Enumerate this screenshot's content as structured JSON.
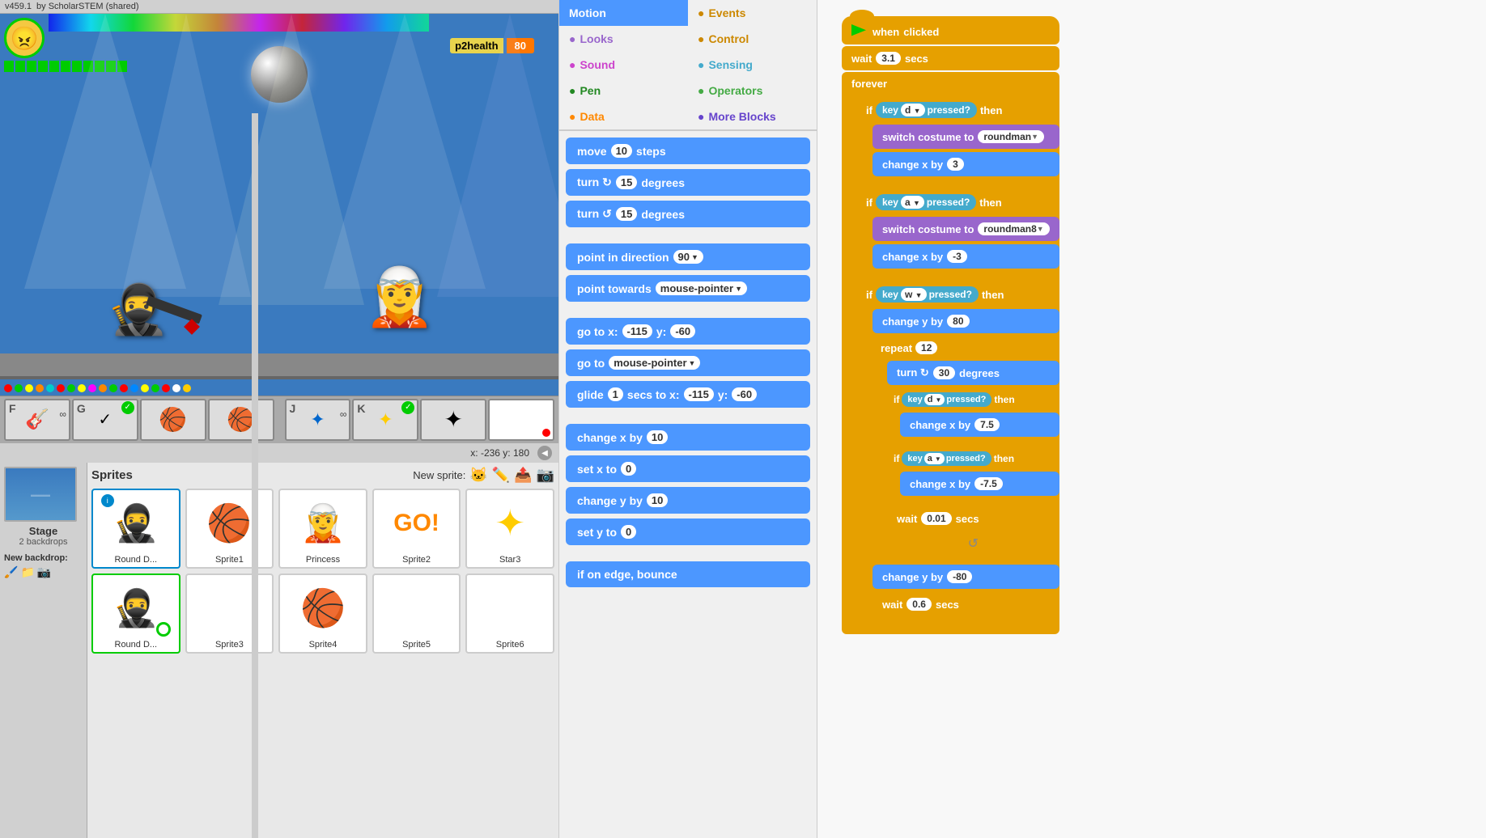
{
  "header": {
    "version": "v459.1",
    "author": "by ScholarSTEM (shared)"
  },
  "game": {
    "health_label": "p2health",
    "health_value": "80",
    "coords": "x: -236  y: 180"
  },
  "categories": [
    {
      "id": "motion",
      "label": "Motion",
      "color": "#4c97ff",
      "active": true
    },
    {
      "id": "events",
      "label": "Events",
      "color": "#cc8800"
    },
    {
      "id": "looks",
      "label": "Looks",
      "color": "#9966cc"
    },
    {
      "id": "control",
      "label": "Control",
      "color": "#cc8800"
    },
    {
      "id": "sound",
      "label": "Sound",
      "color": "#cc44cc"
    },
    {
      "id": "sensing",
      "label": "Sensing",
      "color": "#44aacc"
    },
    {
      "id": "pen",
      "label": "Pen",
      "color": "#228822"
    },
    {
      "id": "operators",
      "label": "Operators",
      "color": "#44aa44"
    },
    {
      "id": "data",
      "label": "Data",
      "color": "#ff8800"
    },
    {
      "id": "more",
      "label": "More Blocks",
      "color": "#6644cc"
    }
  ],
  "blocks": [
    {
      "id": "move",
      "text": "move",
      "val": "10",
      "suffix": "steps"
    },
    {
      "id": "turn_cw",
      "text": "turn ↻",
      "val": "15",
      "suffix": "degrees"
    },
    {
      "id": "turn_ccw",
      "text": "turn ↺",
      "val": "15",
      "suffix": "degrees"
    },
    {
      "id": "point_dir",
      "text": "point in direction",
      "val": "90",
      "dropdown": true
    },
    {
      "id": "point_towards",
      "text": "point towards",
      "val": "mouse-pointer",
      "dropdown": true
    },
    {
      "id": "goto_xy",
      "text": "go to x:",
      "x": "-115",
      "y": "-60"
    },
    {
      "id": "goto",
      "text": "go to",
      "val": "mouse-pointer",
      "dropdown": true
    },
    {
      "id": "glide",
      "text": "glide",
      "val": "1",
      "suffix": "secs to x:",
      "x": "-115",
      "y": "-60"
    },
    {
      "id": "change_x",
      "text": "change x by",
      "val": "10"
    },
    {
      "id": "set_x",
      "text": "set x to",
      "val": "0"
    },
    {
      "id": "change_y",
      "text": "change y by",
      "val": "10"
    },
    {
      "id": "set_y",
      "text": "set y to",
      "val": "0"
    },
    {
      "id": "bounce",
      "text": "if on edge, bounce"
    }
  ],
  "sprites": {
    "title": "Sprites",
    "new_sprite_label": "New sprite:",
    "list": [
      {
        "id": "round_d",
        "label": "Round D...",
        "emoji": "🥷",
        "selected": true,
        "info": true
      },
      {
        "id": "sprite1",
        "label": "Sprite1",
        "emoji": "🏀"
      },
      {
        "id": "princess",
        "label": "Princess",
        "emoji": "🧝"
      },
      {
        "id": "sprite2",
        "label": "Sprite2",
        "emoji": "GO!"
      },
      {
        "id": "star3",
        "label": "Star3",
        "emoji": "⭐"
      },
      {
        "id": "round_d2",
        "label": "Round D...",
        "emoji": "🥷",
        "selected_green": true
      },
      {
        "id": "sprite3",
        "label": "Sprite3",
        "emoji": ""
      },
      {
        "id": "sprite4",
        "label": "Sprite4",
        "emoji": "🏀"
      },
      {
        "id": "sprite5",
        "label": "Sprite5",
        "emoji": ""
      },
      {
        "id": "sprite6",
        "label": "Sprite6",
        "emoji": ""
      }
    ]
  },
  "stage": {
    "label": "Stage",
    "backdrops": "2 backdrops",
    "new_backdrop": "New backdrop:"
  },
  "script": {
    "when_clicked": "when",
    "flag": "🚩",
    "clicked": "clicked",
    "wait_val": "3.1",
    "forever_label": "forever",
    "if1": {
      "key": "d",
      "label": "pressed?",
      "then": "then",
      "costume": "roundman",
      "change_x": "3"
    },
    "if2": {
      "key": "a",
      "label": "pressed?",
      "then": "then",
      "costume": "roundman8",
      "change_x": "-3"
    },
    "if3": {
      "key": "w",
      "label": "pressed?",
      "then": "then",
      "change_y": "80",
      "repeat_val": "12",
      "turn_val": "30",
      "nested_if_d_key": "d",
      "nested_change_x": "7.5",
      "nested_if_a_key": "a",
      "nested_change_x2": "-7.5",
      "wait_val2": "0.01"
    },
    "change_y_neg": "-80",
    "wait_val3": "0.6"
  },
  "sprite_bar": [
    {
      "letter": "F",
      "emoji": "🎸",
      "badge": "∞"
    },
    {
      "letter": "G",
      "emoji": "✓",
      "badge": "check"
    },
    {
      "letter": "",
      "emoji": "🏀"
    },
    {
      "letter": "",
      "emoji": "🏀"
    },
    {
      "letter": "J",
      "emoji": "✦",
      "badge": "∞"
    },
    {
      "letter": "K",
      "emoji": "✓",
      "badge": "check"
    },
    {
      "letter": "",
      "emoji": "✦"
    },
    {
      "letter": "",
      "emoji": ""
    }
  ]
}
